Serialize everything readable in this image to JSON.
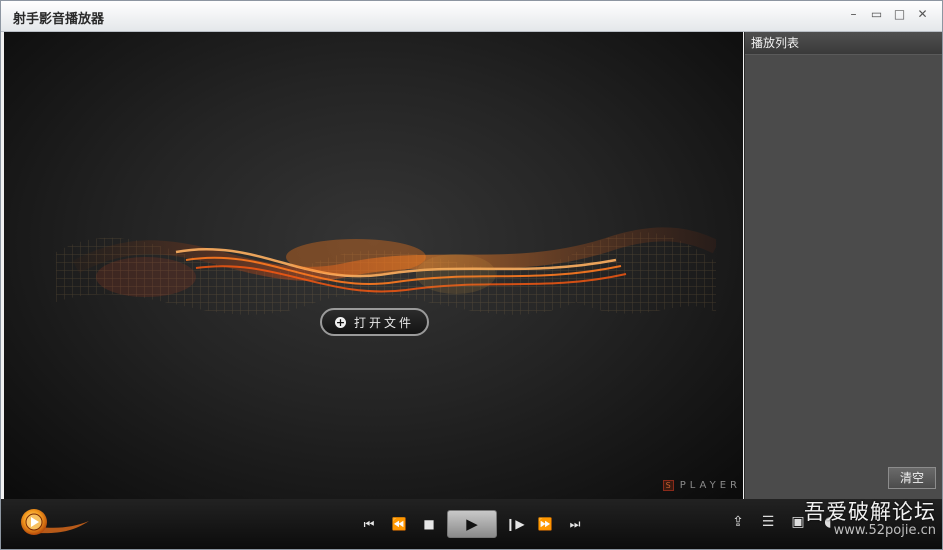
{
  "window": {
    "title": "射手影音播放器",
    "controls": {
      "minimize_icon": "minimize-icon",
      "maximize_icon": "maximize-icon",
      "close_icon": "close-icon"
    }
  },
  "video": {
    "open_file_label": "打开文件",
    "logo_text": "PLAYER",
    "logo_mark": "S"
  },
  "playlist": {
    "header": "播放列表",
    "clear_label": "清空"
  },
  "controls": {
    "buttons": [
      {
        "name": "previous-button",
        "icon": "skip-back-icon"
      },
      {
        "name": "rewind-button",
        "icon": "rewind-icon"
      },
      {
        "name": "stop-button",
        "icon": "stop-icon"
      },
      {
        "name": "play-button",
        "icon": "play-icon"
      },
      {
        "name": "frame-step-button",
        "icon": "frame-step-icon"
      },
      {
        "name": "fast-forward-button",
        "icon": "fast-forward-icon"
      },
      {
        "name": "next-button",
        "icon": "skip-forward-icon"
      }
    ]
  },
  "watermark": {
    "line1": "吾爱破解论坛",
    "line2": "www.52pojie.cn"
  },
  "colors": {
    "accent": "#f08a20",
    "video_bg": "#1c1c1c",
    "playlist_bg": "#4b4b4b"
  }
}
